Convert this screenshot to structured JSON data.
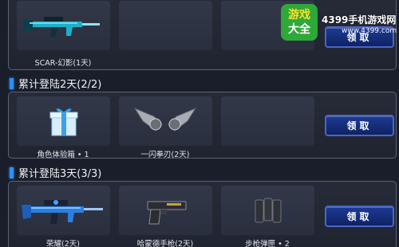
{
  "sections": [
    {
      "items": [
        {
          "label": "SCAR-幻影(1天)",
          "icon": "rifle-icon"
        },
        {
          "label": "",
          "icon": ""
        },
        {
          "label": "",
          "icon": ""
        }
      ],
      "button": "领取"
    },
    {
      "title": "累计登陆2天(2/2)",
      "items": [
        {
          "label": "角色体验箱 • 1",
          "icon": "gift-box-icon"
        },
        {
          "label": "一闪拳刃(2天)",
          "icon": "fist-blade-icon"
        },
        {
          "label": "",
          "icon": ""
        }
      ],
      "button": "领取"
    },
    {
      "title": "累计登陆3天(3/3)",
      "items": [
        {
          "label": "荣耀(2天)",
          "icon": "rifle-icon"
        },
        {
          "label": "哈蒙德手枪(2天)",
          "icon": "pistol-icon"
        },
        {
          "label": "步枪弹匣 • 2",
          "icon": "magazine-icon"
        }
      ],
      "button": "领取"
    }
  ],
  "watermark": {
    "box_top": "游戏",
    "box_bottom": "大全",
    "site_name": "4399手机游戏网",
    "url": "www.4399.com"
  },
  "colors": {
    "accent_blue": "#2f8ff0",
    "button_blue": "#1d3a93",
    "panel_bg": "#262b38",
    "page_bg": "#1a1e2a"
  }
}
